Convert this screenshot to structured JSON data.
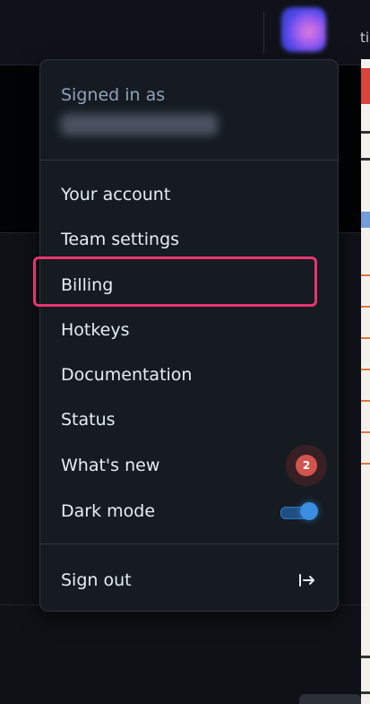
{
  "topbar": {
    "cut_text": "ti"
  },
  "menu": {
    "signed_in_label": "Signed in as",
    "items": [
      {
        "label": "Your account"
      },
      {
        "label": "Team settings"
      },
      {
        "label": "Billing",
        "highlighted": true
      },
      {
        "label": "Hotkeys"
      },
      {
        "label": "Documentation"
      },
      {
        "label": "Status"
      },
      {
        "label": "What's new",
        "badge": "2"
      },
      {
        "label": "Dark mode",
        "toggle_on": true
      }
    ],
    "sign_out_label": "Sign out",
    "icons": {
      "whats_new": "notification-badge-icon",
      "dark_mode": "toggle-switch-icon",
      "sign_out": "sign-out-arrow-icon"
    }
  },
  "colors": {
    "highlight": "#e8356d",
    "badge": "#d0544d",
    "toggle": "#3a8de0"
  }
}
